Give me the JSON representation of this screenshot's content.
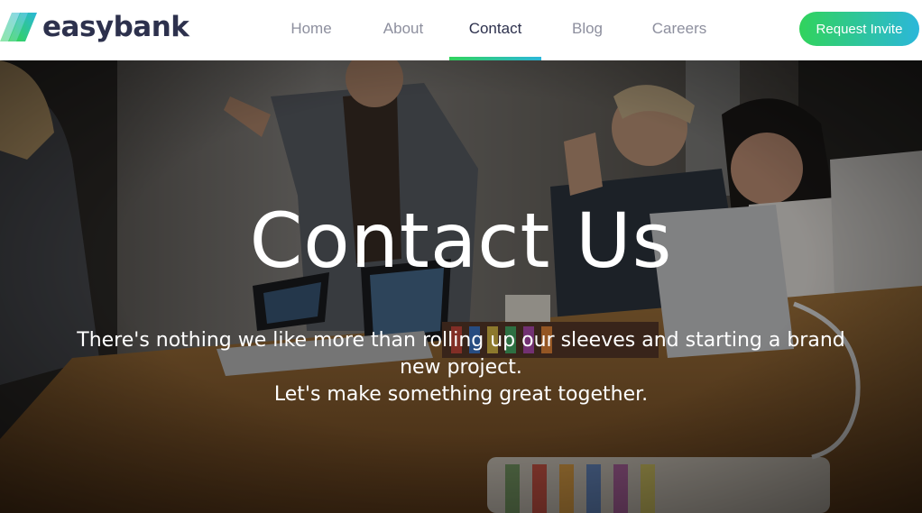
{
  "brand": {
    "name": "easybank",
    "text_color": "#2d314d",
    "gradient": [
      "#31d35c",
      "#2bb7da"
    ],
    "icon": "easybank-logo-icon"
  },
  "nav": {
    "items": [
      {
        "label": "Home",
        "active": false
      },
      {
        "label": "About",
        "active": false
      },
      {
        "label": "Contact",
        "active": true
      },
      {
        "label": "Blog",
        "active": false
      },
      {
        "label": "Careers",
        "active": false
      }
    ],
    "active_color": "#2d314d",
    "inactive_color": "#8d8f9e"
  },
  "cta": {
    "label": "Request Invite"
  },
  "hero": {
    "title": "Contact Us",
    "subtitle_line1": "There's nothing we like more than rolling up our sleeves and starting a brand new project.",
    "subtitle_line2": "Let's make something great together.",
    "image": "team-meeting-photo"
  }
}
